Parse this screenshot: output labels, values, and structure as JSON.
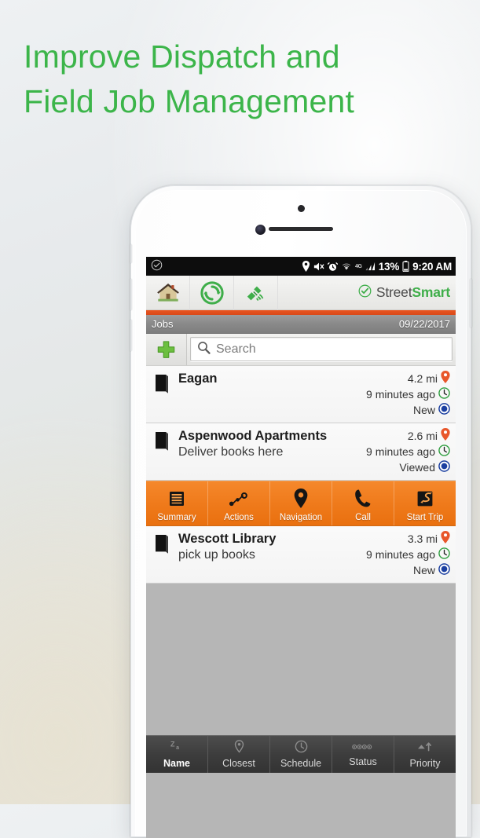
{
  "headline": "Improve Dispatch and\nField Job Management",
  "colors": {
    "green": "#3cb54a",
    "orange": "#ef7a1b",
    "orange_rule": "#e8551f",
    "status_blue": "#1b3fa0",
    "pin_orange": "#e8562a",
    "clock_green": "#2f9e3f"
  },
  "status_bar": {
    "left_icon": "check-circle-icon",
    "icons": [
      "location-pin-icon",
      "mute-icon",
      "alarm-icon",
      "wifi-icon",
      "signal-bars-icon"
    ],
    "network": "4G",
    "battery_percent": "13%",
    "time": "9:20 AM"
  },
  "app_bar": {
    "buttons": [
      {
        "name": "home-icon",
        "label": "Home"
      },
      {
        "name": "sync-icon",
        "label": "Sync"
      },
      {
        "name": "gps-satellite-icon",
        "label": "GPS"
      }
    ],
    "brand_first": "Street",
    "brand_second": "Smart"
  },
  "title_bar": {
    "title": "Jobs",
    "date": "09/22/2017"
  },
  "search": {
    "add_label": "+",
    "placeholder": "Search",
    "value": ""
  },
  "jobs": [
    {
      "icon": "book-icon",
      "title": "Eagan",
      "subtitle": "",
      "distance": "4.2 mi",
      "time": "9 minutes ago",
      "status": "New",
      "expanded": false
    },
    {
      "icon": "book-icon",
      "title": "Aspenwood Apartments",
      "subtitle": "Deliver books here",
      "distance": "2.6 mi",
      "time": "9 minutes ago",
      "status": "Viewed",
      "expanded": true
    },
    {
      "icon": "book-icon",
      "title": "Wescott Library",
      "subtitle": "pick up books",
      "distance": "3.3 mi",
      "time": "9 minutes ago",
      "status": "New",
      "expanded": false
    }
  ],
  "action_bar": [
    {
      "icon": "summary-list-icon",
      "label": "Summary"
    },
    {
      "icon": "actions-route-icon",
      "label": "Actions"
    },
    {
      "icon": "navigation-pin-icon",
      "label": "Navigation"
    },
    {
      "icon": "phone-call-icon",
      "label": "Call"
    },
    {
      "icon": "start-trip-icon",
      "label": "Start Trip"
    }
  ],
  "bottom_nav": [
    {
      "icon": "sort-za-icon",
      "label": "Name",
      "active": true
    },
    {
      "icon": "closest-pin-icon",
      "label": "Closest",
      "active": false
    },
    {
      "icon": "schedule-clock-icon",
      "label": "Schedule",
      "active": false
    },
    {
      "icon": "status-dots-icon",
      "label": "Status",
      "active": false
    },
    {
      "icon": "priority-arrows-icon",
      "label": "Priority",
      "active": false
    }
  ]
}
